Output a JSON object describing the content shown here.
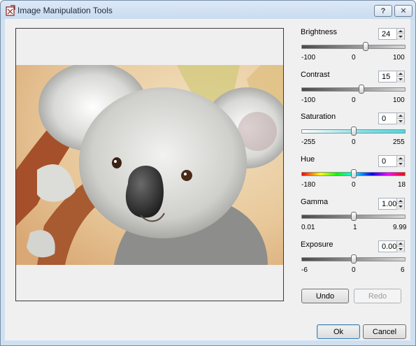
{
  "window": {
    "title": "Image Manipulation Tools"
  },
  "titlebar_buttons": {
    "help": "?",
    "close": "✕"
  },
  "controls": {
    "brightness": {
      "label": "Brightness",
      "value": "24",
      "min": "-100",
      "mid": "0",
      "max": "100",
      "level": 0.62
    },
    "contrast": {
      "label": "Contrast",
      "value": "15",
      "min": "-100",
      "mid": "0",
      "max": "100",
      "level": 0.575
    },
    "saturation": {
      "label": "Saturation",
      "value": "0",
      "min": "-255",
      "mid": "0",
      "max": "255",
      "level": 0.5
    },
    "hue": {
      "label": "Hue",
      "value": "0",
      "min": "-180",
      "mid": "0",
      "max": "18",
      "level": 0.5
    },
    "gamma": {
      "label": "Gamma",
      "value": "1.00",
      "min": "0.01",
      "mid": "1",
      "max": "9.99",
      "level": 0.5
    },
    "exposure": {
      "label": "Exposure",
      "value": "0.00",
      "min": "-6",
      "mid": "0",
      "max": "6",
      "level": 0.5
    }
  },
  "buttons": {
    "undo": "Undo",
    "redo": "Redo",
    "ok": "Ok",
    "cancel": "Cancel"
  },
  "colors": {
    "titlebar": "#c8dbef",
    "saturation_track": "#7fe0e6",
    "default_border": "#3c7fb1"
  }
}
